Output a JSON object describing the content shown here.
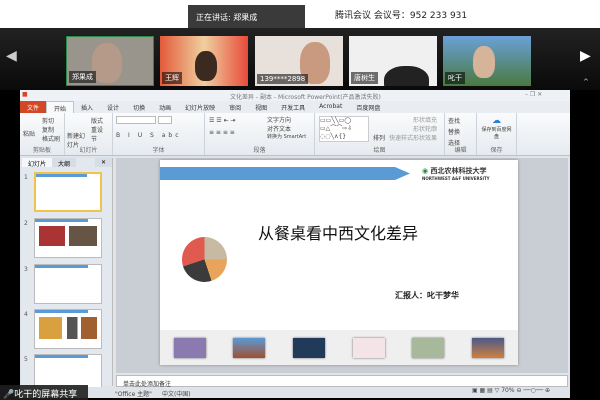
{
  "meeting": {
    "title": "腾讯会议 会议号：952 233 931",
    "speaking": "正在讲话: 郑果成"
  },
  "participants": [
    {
      "name": "郑果成"
    },
    {
      "name": "王辉"
    },
    {
      "name": "139****2898"
    },
    {
      "name": "唐树生"
    },
    {
      "name": "叱干"
    }
  ],
  "ppt": {
    "window_title": "文化差异 - 副本 - Microsoft PowerPoint(产品激活失败)",
    "tabs": [
      "文件",
      "开始",
      "插入",
      "设计",
      "切换",
      "动画",
      "幻灯片放映",
      "审阅",
      "视图",
      "开发工具",
      "Acrobat",
      "百度网盘"
    ],
    "groups": [
      "剪贴板",
      "幻灯片",
      "字体",
      "段落",
      "绘图",
      "编辑",
      "保存"
    ],
    "ribbon_buttons": {
      "paste": "粘贴",
      "cut": "剪切",
      "copy": "复制",
      "format_painter": "格式刷",
      "new_slide": "新建幻灯片",
      "layout": "版式",
      "reset": "重设",
      "section": "节",
      "text_direction": "文字方向",
      "align_text": "对齐文本",
      "smartart": "转换为 SmartArt",
      "arrange": "排列",
      "quick_styles": "快速样式",
      "shape_fill": "形状填充",
      "shape_outline": "形状轮廓",
      "shape_effects": "形状效果",
      "find": "查找",
      "replace": "替换",
      "select": "选择",
      "save_baidu": "保存到百度网盘"
    },
    "pane_tabs": [
      "幻灯片",
      "大纲"
    ],
    "slide_numbers": [
      "1",
      "2",
      "3",
      "4",
      "5"
    ],
    "slide": {
      "university": "西北农林科技大学",
      "university_en": "NORTHWEST A&F UNIVERSITY",
      "title": "从餐桌看中西文化差异",
      "reporter": "汇报人：叱干梦华"
    },
    "notes_placeholder": "单击此处添加备注",
    "status": {
      "theme": "\"Office 主题\"",
      "language": "中文(中国)",
      "zoom": "70%"
    }
  },
  "share_label": "叱干的屏幕共享"
}
